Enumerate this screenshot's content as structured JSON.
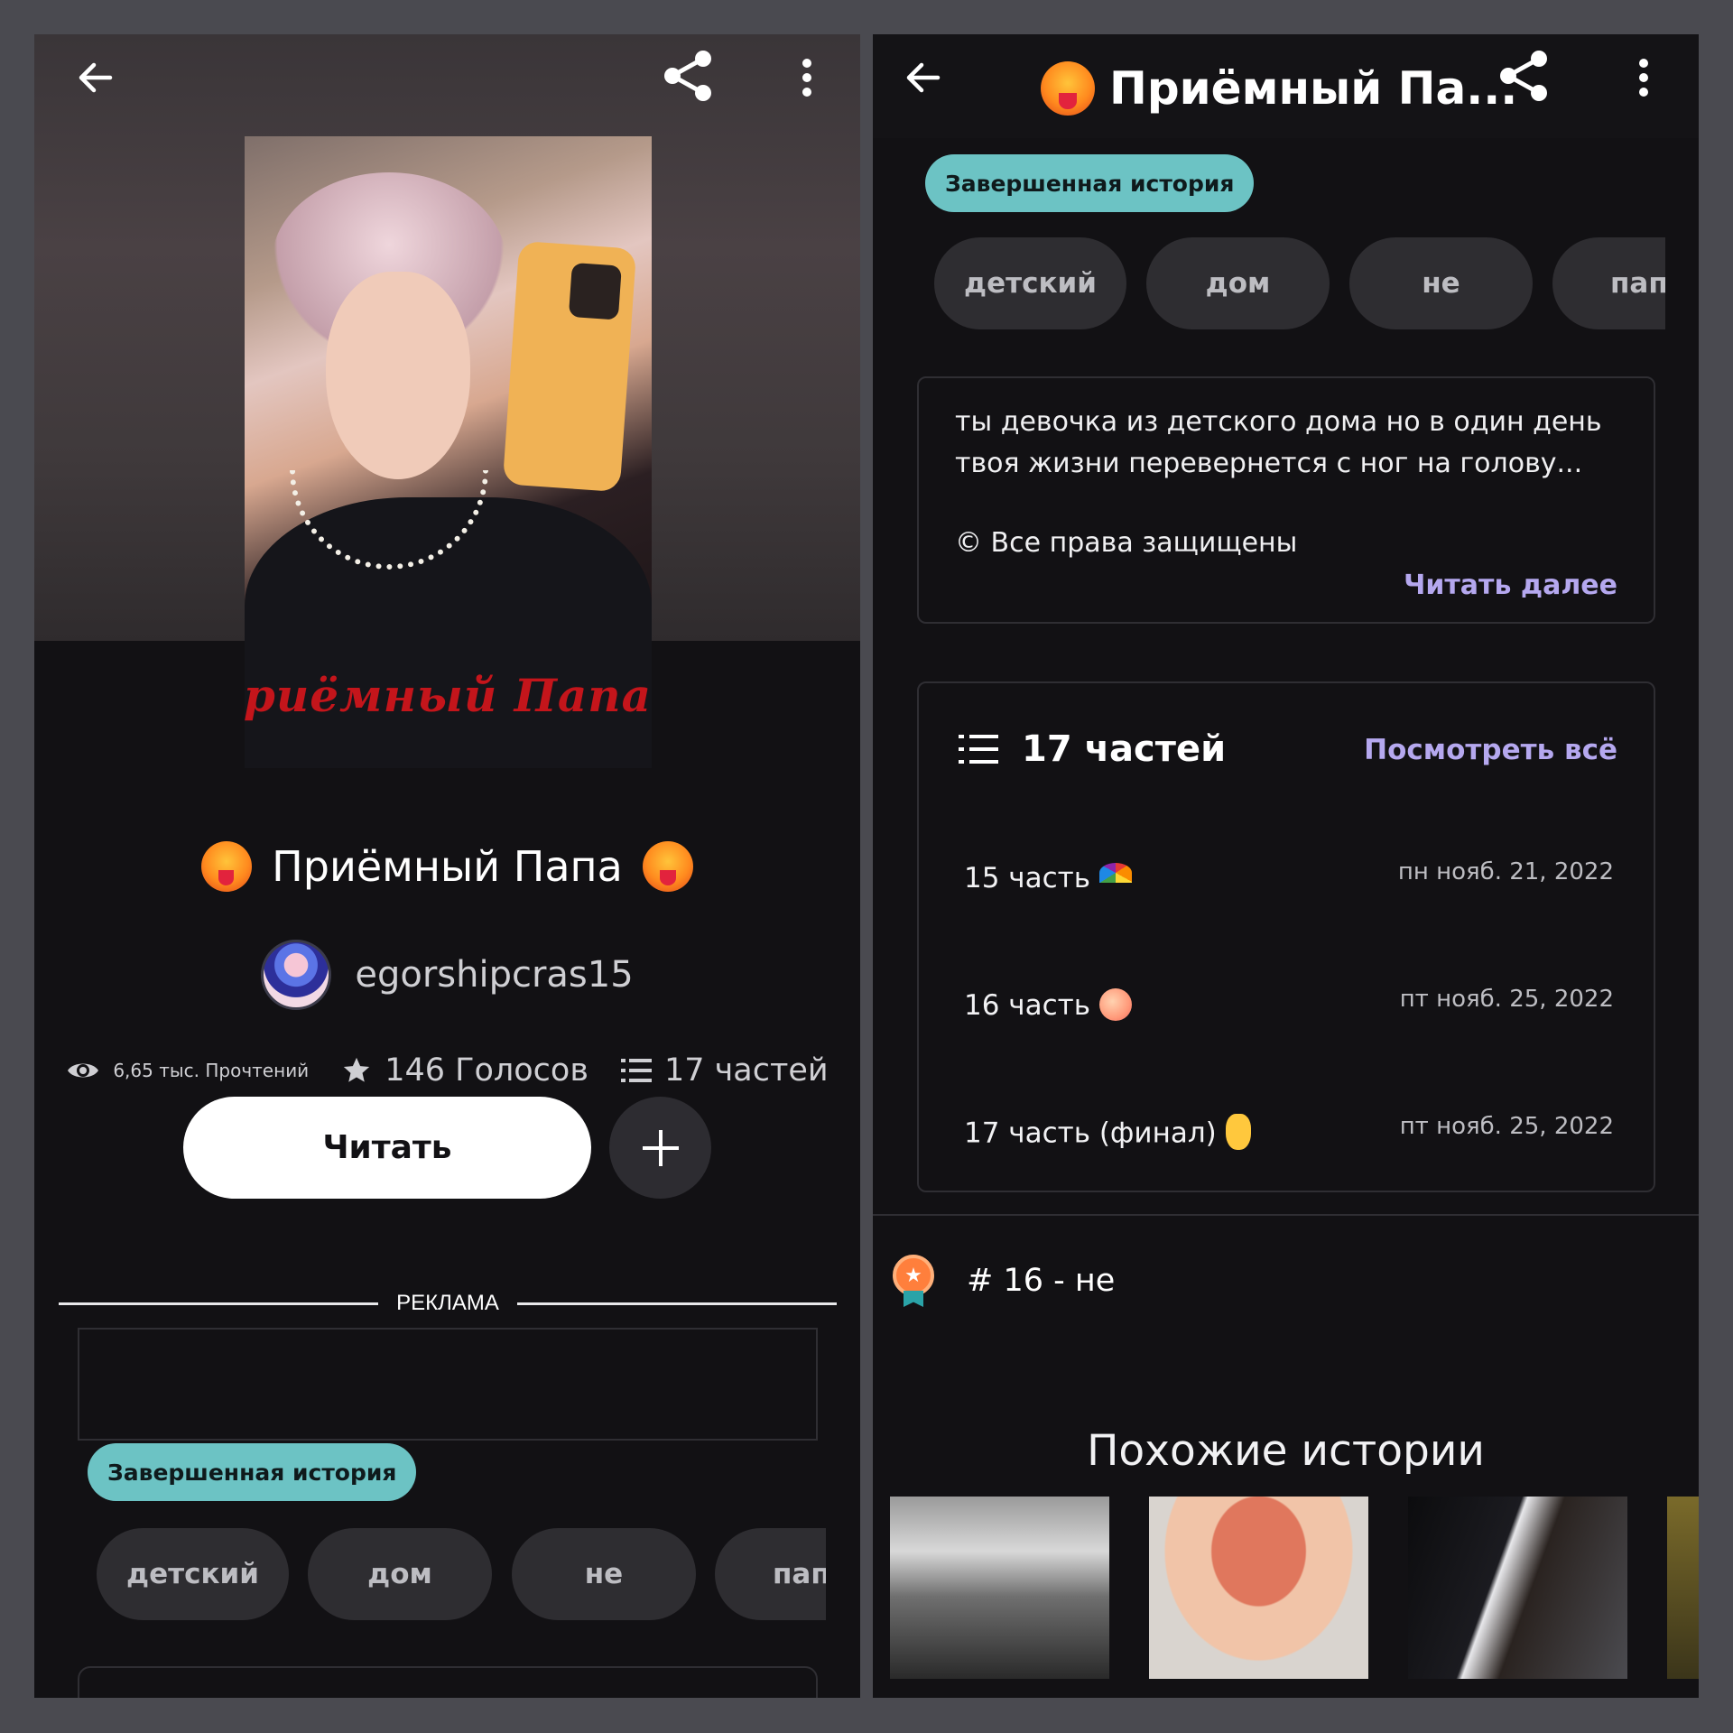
{
  "left": {
    "cover_caption": "риёмный Папа",
    "title": "Приёмный Папа",
    "author": "egorshipcras15",
    "stats": {
      "reads": "6,65 тыс. Прочтений",
      "votes": "146 Голосов",
      "parts": "17 частей"
    },
    "read_button": "Читать",
    "ad_label": "РЕКЛАМА",
    "status_badge": "Завершенная история",
    "tags": [
      "детский",
      "дом",
      "не",
      "папа"
    ]
  },
  "right": {
    "title": "Приёмный Па...",
    "status_badge": "Завершенная история",
    "tags": [
      "детский",
      "дом",
      "не",
      "папа"
    ],
    "description": "ты девочка из детского дома но в один день твоя жизни перевернется с ног на голову...",
    "copyright": "© Все права защищены",
    "read_more": "Читать далее",
    "parts_header": "17 частей",
    "see_all": "Посмотреть всё",
    "parts": [
      {
        "title": "15 часть",
        "emoji": "rainbow",
        "date": "пн нояб. 21, 2022"
      },
      {
        "title": "16 часть",
        "emoji": "peach",
        "date": "пт нояб. 25, 2022"
      },
      {
        "title": "17 часть (финал)",
        "emoji": "victory-hand",
        "date": "пт нояб. 25, 2022"
      }
    ],
    "rank": "# 16 - не",
    "similar_title": "Похожие истории"
  },
  "colors": {
    "background": "#121114",
    "badge": "#6cc3c4",
    "link": "#b5a8ef",
    "tag_bg": "#2e2d31"
  }
}
